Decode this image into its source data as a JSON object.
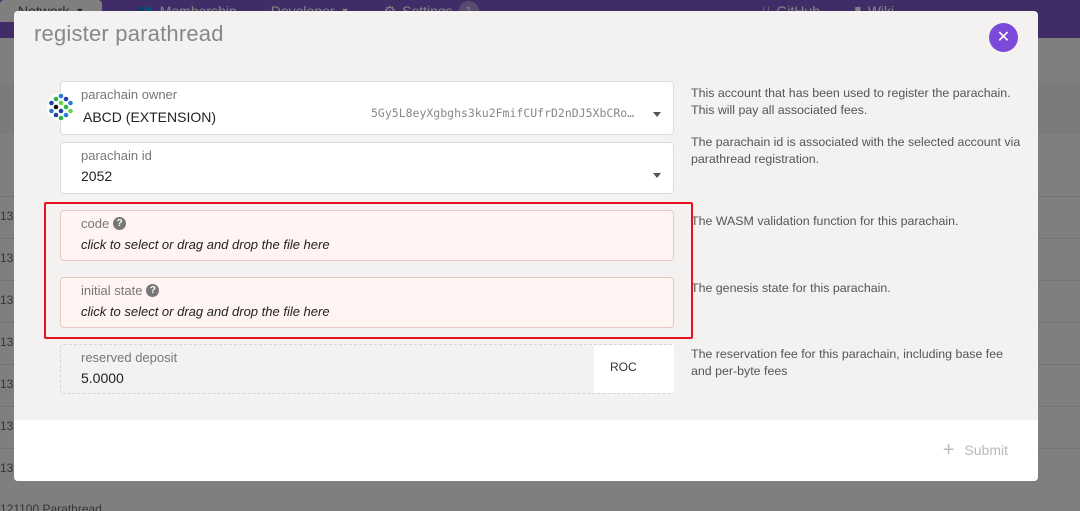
{
  "background": {
    "nav": [
      {
        "label": "Network",
        "icon": "chevron-down-icon"
      },
      {
        "label": "Membership",
        "icon": "users-icon"
      },
      {
        "label": "Developer",
        "icon": "chevron-down-icon"
      },
      {
        "label": "Settings",
        "icon": "gear-icon",
        "badge": "1"
      },
      {
        "label": "GitHub",
        "icon": "branch-icon"
      },
      {
        "label": "Wiki",
        "icon": "book-icon"
      }
    ],
    "rows": [
      "13",
      "13",
      "13",
      "13",
      "13",
      "13",
      "13"
    ],
    "last_row": "121100    Parathread"
  },
  "modal": {
    "title": "register parathread",
    "close_icon": "close-icon",
    "owner": {
      "label": "parachain owner",
      "value": "ABCD (EXTENSION)",
      "address": "5Gy5L8eyXgbghs3ku2FmifCUfrD2nDJ5XbCRo…",
      "help": "This account that has been used to register the parachain. This will pay all associated fees."
    },
    "para_id": {
      "label": "parachain id",
      "value": "2052",
      "help": "The parachain id is associated with the selected account via parathread registration."
    },
    "code": {
      "label": "code",
      "placeholder": "click to select or drag and drop the file here",
      "help": "The WASM validation function for this parachain."
    },
    "initial_state": {
      "label": "initial state",
      "placeholder": "click to select or drag and drop the file here",
      "help": "The genesis state for this parachain."
    },
    "deposit": {
      "label": "reserved deposit",
      "value": "5.0000",
      "unit": "ROC",
      "help": "The reservation fee for this parachain, including base fee and per-byte fees"
    },
    "submit_label": "Submit",
    "colors": {
      "accent": "#7c4ad8",
      "highlight": "#e8121a",
      "topbar": "#7c56c8"
    }
  }
}
